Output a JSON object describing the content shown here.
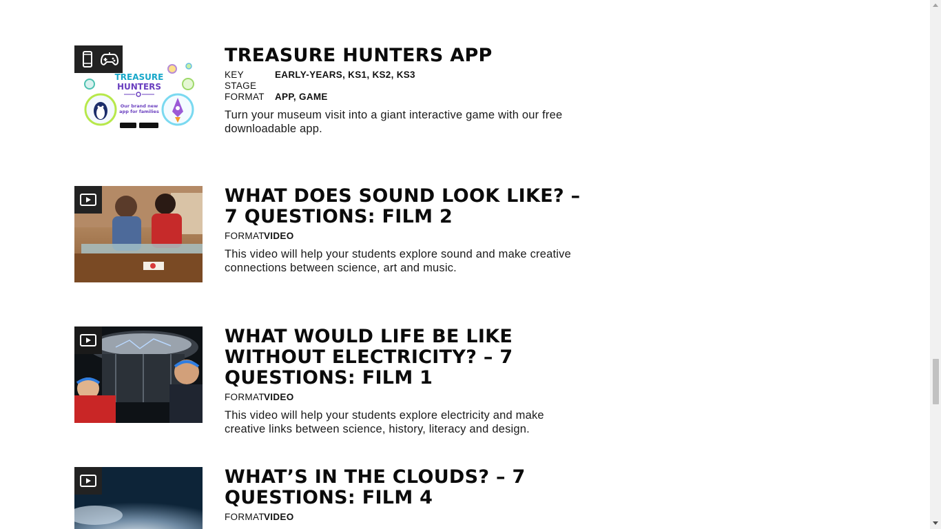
{
  "labels": {
    "key_stage": "KEY STAGE",
    "format": "FORMAT"
  },
  "items": [
    {
      "title": "TREASURE HUNTERS APP",
      "key_stage": "EARLY-YEARS, KS1, KS2, KS3",
      "format": "APP, GAME",
      "description": "Turn your museum visit into a giant interactive game with our free downloadable app.",
      "badge_icons": [
        "mobile-phone-icon",
        "game-controller-icon"
      ],
      "thumbnail": {
        "line1": "TREASURE",
        "line2": "HUNTERS",
        "tagline": "Our brand new app for families"
      }
    },
    {
      "title": "WHAT DOES SOUND LOOK LIKE? – 7 QUESTIONS: FILM 2",
      "format": "VIDEO",
      "description": "This video will help your students explore sound and make creative connections between science, art and music.",
      "badge_icons": [
        "video-play-icon"
      ]
    },
    {
      "title": "WHAT WOULD LIFE BE LIKE WITHOUT ELECTRICITY? – 7 QUESTIONS: FILM 1",
      "format": "VIDEO",
      "description": "This video will help your students explore electricity and make creative links between science, history, literacy and design.",
      "badge_icons": [
        "video-play-icon"
      ]
    },
    {
      "title": "WHAT’S IN THE CLOUDS? – 7 QUESTIONS: FILM 4",
      "format": "VIDEO",
      "description": "",
      "badge_icons": [
        "video-play-icon"
      ]
    }
  ]
}
